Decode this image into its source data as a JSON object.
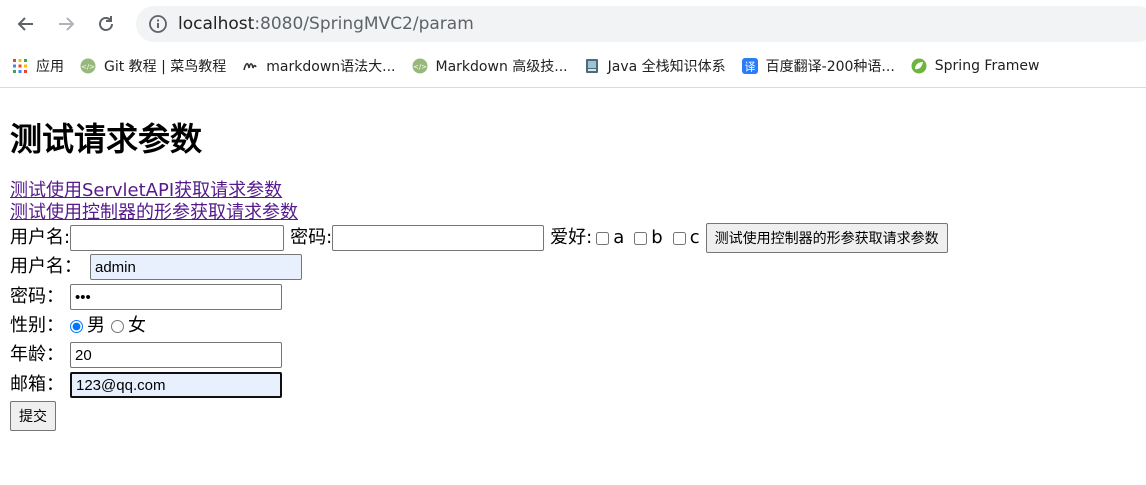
{
  "browser": {
    "url_host": "localhost",
    "url_rest": ":8080/SpringMVC2/param",
    "bookmarks": [
      {
        "label": "应用",
        "icon": "apps-grid-icon"
      },
      {
        "label": "Git 教程 | 菜鸟教程",
        "icon": "runoob-icon"
      },
      {
        "label": "markdown语法大...",
        "icon": "markdown-icon"
      },
      {
        "label": "Markdown 高级技...",
        "icon": "runoob-icon"
      },
      {
        "label": "Java 全栈知识体系",
        "icon": "java-book-icon"
      },
      {
        "label": "百度翻译-200种语...",
        "icon": "baidu-translate-icon"
      },
      {
        "label": "Spring Framew",
        "icon": "spring-leaf-icon"
      }
    ]
  },
  "page": {
    "title": "测试请求参数",
    "links": [
      "测试使用ServletAPI获取请求参数",
      "测试使用控制器的形参获取请求参数"
    ],
    "form1": {
      "username_label": "用户名:",
      "password_label": "密码:",
      "hobby_label": "爱好:",
      "hobbies": [
        "a",
        "b",
        "c"
      ],
      "submit_label": "测试使用控制器的形参获取请求参数"
    },
    "form2": {
      "username_label": "用户名：",
      "username_value": "admin",
      "password_label": "密码：",
      "password_value": "•••",
      "gender_label": "性别：",
      "gender_options": [
        "男",
        "女"
      ],
      "gender_selected": "男",
      "age_label": "年龄：",
      "age_value": "20",
      "email_label": "邮箱：",
      "email_value": "123@qq.com",
      "submit_label": "提交"
    }
  }
}
